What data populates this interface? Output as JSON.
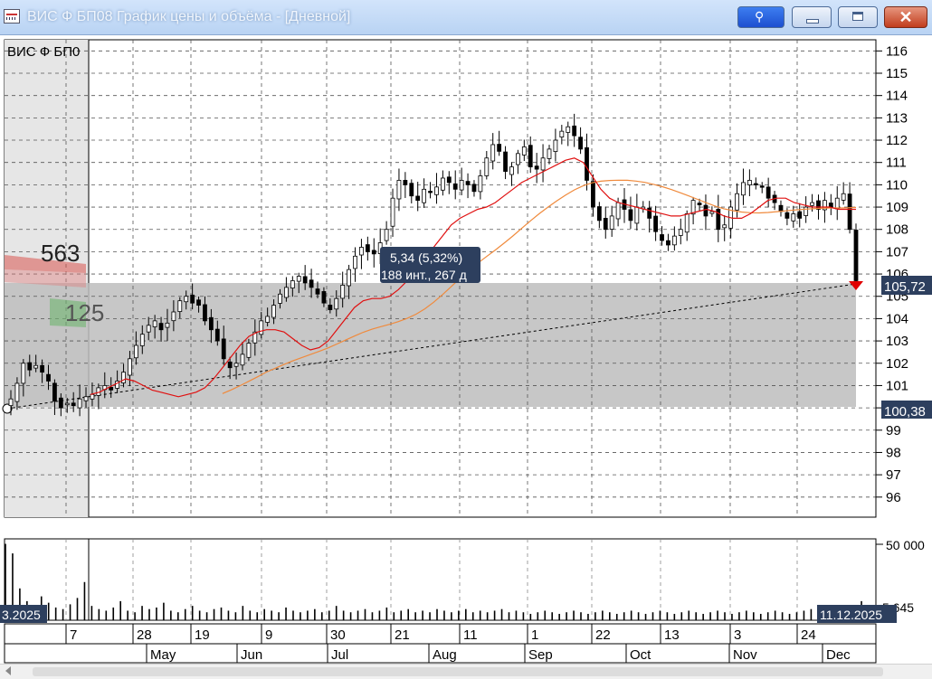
{
  "window": {
    "title": "ВИС Ф БП08 График цены и объёма - [Дневной]"
  },
  "chart_data": {
    "type": "candlestick",
    "instrument_label": "ВИС Ф БП0",
    "ylim": [
      95,
      116.5
    ],
    "y_ticks": [
      96,
      97,
      98,
      99,
      100,
      101,
      102,
      103,
      104,
      105,
      106,
      107,
      108,
      109,
      110,
      111,
      112,
      113,
      114,
      115,
      116
    ],
    "x_dates": [
      "7",
      "28",
      "19",
      "9",
      "30",
      "21",
      "11",
      "1",
      "22",
      "13",
      "3",
      "24"
    ],
    "x_months": [
      "May",
      "Jun",
      "Jul",
      "Aug",
      "Sep",
      "Oct",
      "Nov",
      "Dec"
    ],
    "start_date_label": "3.2025",
    "end_date_label": "11.12.2025",
    "last_price_label": "105,72",
    "lower_level_label": "100,38",
    "measure_label_line1": "5,34 (5,32%)",
    "measure_label_line2": "188 инт., 267 д",
    "volume_profile_upper": "563",
    "volume_profile_lower": "125",
    "volume_axis_label": "50 000",
    "volume_last_label": "5 645",
    "volume_ylim": [
      0,
      50000
    ],
    "colors": {
      "candle": "#000000",
      "ma_fast": "#e01010",
      "ma_slow": "#f08a3c",
      "trend": "#000000",
      "zone": "#bdbdbd",
      "label_bg": "#2d3f5e"
    },
    "close_series": [
      100.4,
      101.1,
      102.0,
      101.7,
      101.9,
      101.6,
      101.2,
      100.3,
      100.0,
      100.2,
      100.1,
      100.4,
      100.5,
      100.6,
      100.9,
      101.0,
      100.8,
      101.2,
      101.6,
      102.2,
      102.8,
      103.3,
      103.7,
      103.9,
      103.5,
      103.8,
      104.3,
      104.8,
      105.0,
      104.7,
      104.6,
      103.9,
      103.5,
      103.0,
      102.2,
      101.8,
      102.0,
      102.4,
      102.9,
      103.4,
      103.9,
      104.1,
      104.6,
      105.1,
      105.4,
      105.7,
      105.9,
      105.6,
      105.4,
      105.1,
      104.7,
      104.4,
      104.9,
      105.5,
      106.2,
      106.8,
      107.2,
      107.0,
      106.9,
      107.4,
      108.0,
      109.4,
      110.2,
      110.0,
      109.5,
      109.3,
      109.8,
      109.7,
      109.9,
      110.3,
      110.1,
      109.8,
      110.2,
      110.0,
      109.7,
      110.4,
      111.2,
      111.8,
      111.5,
      110.6,
      110.8,
      111.4,
      111.7,
      110.8,
      110.7,
      111.2,
      111.6,
      112.0,
      112.4,
      112.6,
      112.2,
      111.6,
      110.2,
      109.0,
      108.4,
      108.0,
      108.6,
      109.2,
      108.9,
      108.4,
      109.0,
      109.0,
      108.5,
      107.9,
      107.5,
      107.3,
      107.7,
      108.0,
      108.7,
      109.3,
      109.1,
      108.6,
      108.8,
      108.0,
      108.2,
      109.0,
      109.6,
      110.1,
      110.2,
      110.0,
      109.9,
      109.4,
      109.2,
      108.8,
      108.5,
      108.7,
      108.5,
      109.0,
      109.2,
      108.9,
      109.3,
      109.0,
      109.4,
      109.6,
      108.0,
      105.7
    ],
    "ma_fast_series": [
      100.6,
      100.7,
      100.9,
      101.1,
      101.3,
      101.2,
      101.0,
      100.8,
      100.7,
      100.6,
      100.5,
      100.6,
      100.7,
      100.9,
      101.3,
      101.8,
      102.3,
      102.8,
      103.2,
      103.4,
      103.5,
      103.5,
      103.4,
      103.1,
      102.8,
      102.6,
      102.7,
      103.0,
      103.5,
      104.0,
      104.5,
      104.8,
      104.9,
      104.9,
      105.0,
      105.3,
      105.7,
      106.2,
      106.7,
      107.2,
      107.7,
      108.2,
      108.5,
      108.7,
      108.9,
      109.0,
      109.2,
      109.5,
      109.8,
      110.1,
      110.3,
      110.5,
      110.7,
      110.9,
      111.1,
      111.2,
      111.0,
      110.4,
      109.8,
      109.4,
      109.2,
      109.1,
      109.0,
      108.9,
      108.8,
      108.7,
      108.6,
      108.6,
      108.7,
      108.8,
      108.9,
      108.8,
      108.6,
      108.5,
      108.5,
      108.7,
      109.0,
      109.3,
      109.4,
      109.4,
      109.2,
      109.1,
      109.0,
      109.0,
      109.0,
      108.9,
      108.9,
      108.9
    ],
    "volume_series": [
      48000,
      42000,
      20000,
      12000,
      9000,
      15000,
      11000,
      8000,
      7000,
      10000,
      14000,
      24000,
      9000,
      7000,
      6000,
      8000,
      12000,
      6000,
      5000,
      9000,
      7000,
      8000,
      11000,
      6000,
      5000,
      7000,
      9000,
      6000,
      5000,
      7000,
      8000,
      6000,
      5000,
      9000,
      6000,
      5000,
      7000,
      6000,
      5000,
      8000,
      6000,
      5000,
      6000,
      7000,
      5000,
      6000,
      9000,
      6000,
      5000,
      6000,
      7000,
      5000,
      6000,
      8000,
      5000,
      6000,
      7000,
      5000,
      6000,
      5000,
      7000,
      6000,
      5000,
      6000,
      7000,
      5000,
      6000,
      5000,
      6000,
      7000,
      5000,
      6000,
      5000,
      4000,
      5000,
      6000,
      5000,
      4000,
      5000,
      6000,
      5000,
      4000,
      5000,
      6000,
      5000,
      4000,
      5000,
      6000,
      5000,
      4000,
      5000,
      6000,
      5000,
      4000,
      5000,
      6000,
      5000,
      4000,
      5000,
      6000,
      5000,
      4000,
      5000,
      6000,
      5000,
      4000,
      5000,
      6000,
      5000,
      4000,
      5000,
      6000,
      7000,
      5000,
      4000,
      5000,
      6000,
      5000,
      8000,
      12000,
      6000
    ]
  }
}
